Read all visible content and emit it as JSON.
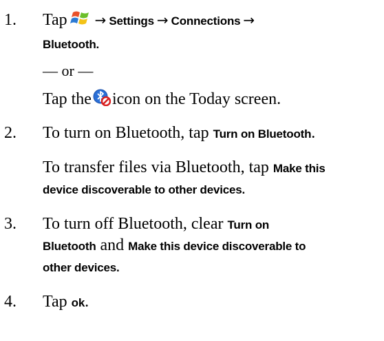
{
  "steps": [
    {
      "number": "1.",
      "prefix": "Tap",
      "icon": "windows-start-icon",
      "path": [
        "Settings",
        "Connections",
        "Bluetooth."
      ],
      "separator": "or",
      "alt_prefix": "Tap the",
      "alt_icon": "bluetooth-off-icon",
      "alt_suffix": "icon on the Today screen."
    },
    {
      "number": "2.",
      "text": "To turn on Bluetooth, tap",
      "ui": "Turn on Bluetooth",
      "end": ".",
      "text2": "To transfer files via Bluetooth, tap",
      "ui2_line1": "Make this",
      "ui2_line2": "device discoverable to other devices."
    },
    {
      "number": "3.",
      "text": "To turn off Bluetooth, clear",
      "ui": "Turn on",
      "ui_line2": "Bluetooth",
      "and": "and",
      "ui2_line2": "Make this device discoverable to",
      "ui2_line3": "other devices."
    },
    {
      "number": "4.",
      "text": "Tap",
      "ui": "ok",
      "end": "."
    }
  ]
}
